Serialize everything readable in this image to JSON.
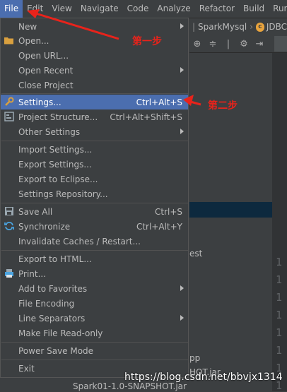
{
  "menubar": {
    "items": [
      {
        "label": "File",
        "active": true
      },
      {
        "label": "Edit"
      },
      {
        "label": "View"
      },
      {
        "label": "Navigate"
      },
      {
        "label": "Code"
      },
      {
        "label": "Analyze"
      },
      {
        "label": "Refactor"
      },
      {
        "label": "Build"
      },
      {
        "label": "Run"
      }
    ]
  },
  "editor_tabs": {
    "crumb1": "SparkMysql",
    "crumb2": "JDBC",
    "badge": "c"
  },
  "file_menu": {
    "new": "New",
    "open": "Open...",
    "open_url": "Open URL...",
    "open_recent": "Open Recent",
    "close_project": "Close Project",
    "settings": "Settings...",
    "settings_shortcut": "Ctrl+Alt+S",
    "project_structure": "Project Structure...",
    "project_structure_shortcut": "Ctrl+Alt+Shift+S",
    "other_settings": "Other Settings",
    "import_settings": "Import Settings...",
    "export_settings": "Export Settings...",
    "export_eclipse": "Export to Eclipse...",
    "settings_repository": "Settings Repository...",
    "save_all": "Save All",
    "save_all_shortcut": "Ctrl+S",
    "synchronize": "Synchronize",
    "synchronize_shortcut": "Ctrl+Alt+Y",
    "invalidate_caches": "Invalidate Caches / Restart...",
    "export_html": "Export to HTML...",
    "print": "Print...",
    "add_favorites": "Add to Favorites",
    "file_encoding": "File Encoding",
    "line_separators": "Line Separators",
    "make_readonly": "Make File Read-only",
    "power_save": "Power Save Mode",
    "exit": "Exit"
  },
  "background": {
    "est": "est",
    "pp": "pp",
    "hot_jar": "HOT.jar",
    "snapshot_jar": "Spark01-1.0-SNAPSHOT.jar",
    "line_numbers": [
      "1",
      "1",
      "1",
      "1",
      "1",
      "1",
      "1",
      "1"
    ]
  },
  "annotations": {
    "step1": "第一步",
    "step2": "第二步",
    "color": "#e8231b"
  },
  "watermark": "https://blog.csdn.net/bbvjx1314",
  "colors": {
    "menu_bg": "#3c3f41",
    "selection": "#4b6eaf",
    "text": "#bbbbbb"
  }
}
